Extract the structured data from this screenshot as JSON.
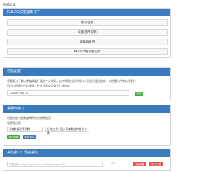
{
  "page": {
    "top_title": "编辑设置"
  },
  "panel1": {
    "title": "EMLOG深度翻新补丁",
    "buttons": [
      "版权说明",
      "采集使用说明",
      "编辑器说明",
      "EMLOG编辑器说明"
    ]
  },
  "panel2": {
    "title": "初始设置",
    "line1": "您需要为了解以便编辑器扩展进一步改动，若有开通对应的接口人员自己通过操作：对接接口所有信息前往",
    "line2": "您可以根据自己的需求，在此设置以及其它扩展完成",
    "input_value": "1234567654157",
    "save_label": "保存"
  },
  "panel3": {
    "title": "采编的接口",
    "line1": "根据自定义参数编辑予来采集数据源",
    "line2": "设置到内容",
    "select_value": "采集数据源等参数",
    "input_value": "接收方式：接入采集数据的相关参数",
    "btn_add": "添加采集",
    "btn_save": "保存提交"
  },
  "panel4": {
    "title": "采集窗口：源接采集",
    "input_placeholder": "采集地址：http://https://www.mediocity.com/post?5",
    "counter": "0/4",
    "btn_start": "开始采集",
    "btn_clear": "清空列表"
  }
}
